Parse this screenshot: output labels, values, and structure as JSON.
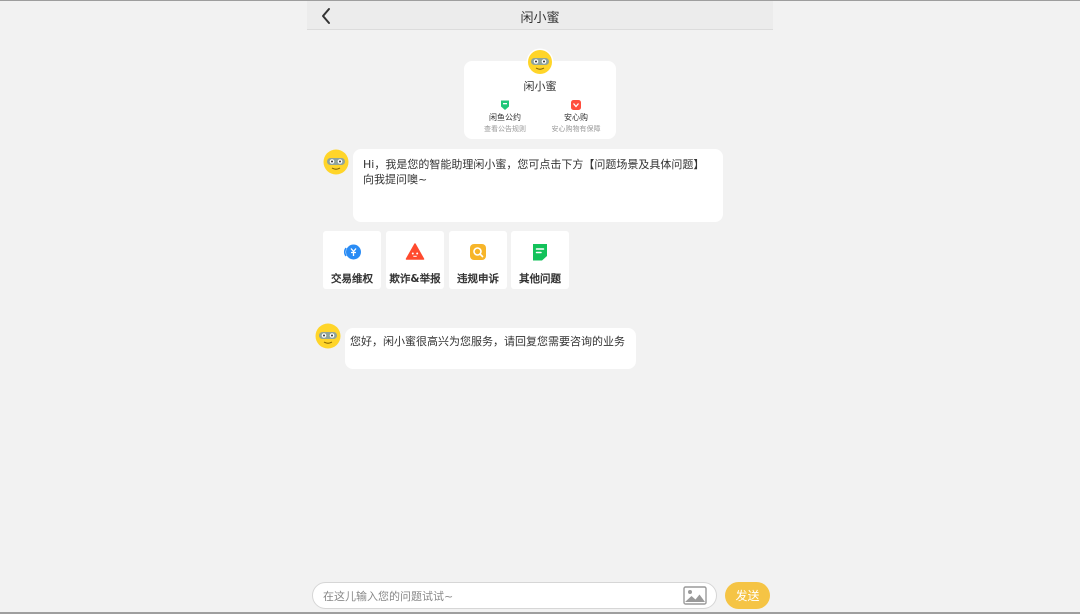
{
  "header": {
    "title": "闲小蜜",
    "back_icon": "chevron-left-icon"
  },
  "profile_card": {
    "name": "闲小蜜",
    "links": [
      {
        "title": "闲鱼公约",
        "subtitle": "查看公告规则",
        "icon": "shield-icon",
        "color": "#1fc77a"
      },
      {
        "title": "安心购",
        "subtitle": "安心购物有保障",
        "icon": "heart-badge-icon",
        "color": "#ff4d3d"
      }
    ]
  },
  "messages": [
    {
      "text": "Hi，我是您的智能助理闲小蜜，您可点击下方【问题场景及具体问题】向我提问噢~"
    },
    {
      "text": "您好，闲小蜜很高兴为您服务，请回复您需要咨询的业务"
    }
  ],
  "quick_actions": [
    {
      "label": "交易维权",
      "icon": "yuan-refund-icon",
      "color": "#2a8cf5"
    },
    {
      "label": "欺诈&举报",
      "icon": "warning-icon",
      "color": "#ff4a2e"
    },
    {
      "label": "违规申诉",
      "icon": "search-appeal-icon",
      "color": "#f7b529"
    },
    {
      "label": "其他问题",
      "icon": "document-icon",
      "color": "#12c25a"
    }
  ],
  "composer": {
    "placeholder": "在这儿输入您的问题试试~",
    "send_label": "发送",
    "image_icon": "image-icon",
    "accent": "#f5c445"
  }
}
